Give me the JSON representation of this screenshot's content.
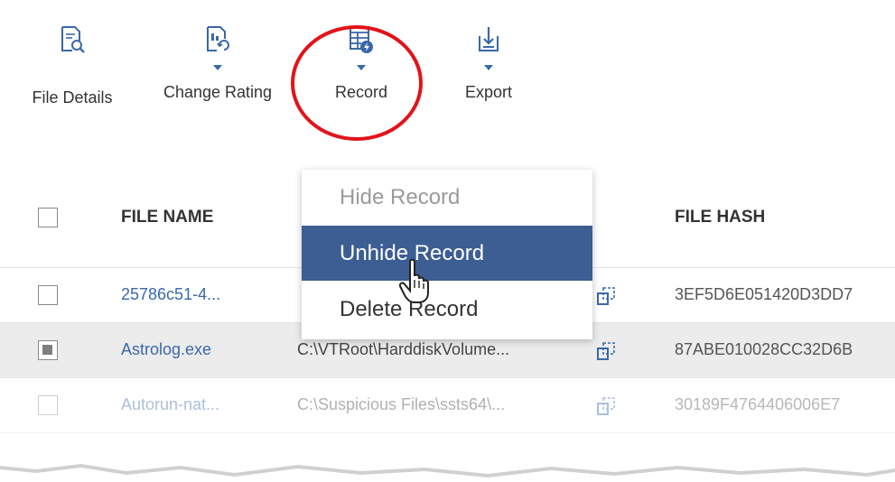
{
  "toolbar": {
    "items": [
      {
        "label": "File Details",
        "icon": "file-search-icon",
        "has_dropdown": false
      },
      {
        "label": "Change Rating",
        "icon": "file-refresh-icon",
        "has_dropdown": true
      },
      {
        "label": "Record",
        "icon": "record-lightning-icon",
        "has_dropdown": true
      },
      {
        "label": "Export",
        "icon": "export-icon",
        "has_dropdown": true
      }
    ],
    "highlight_color": "#e2131a"
  },
  "table": {
    "columns": [
      "FILE NAME",
      "FILE HASH"
    ],
    "rows": [
      {
        "checked": false,
        "name": "25786c51-4...",
        "path": "",
        "hash": "3EF5D6E051420D3DD7"
      },
      {
        "checked": true,
        "name": "Astrolog.exe",
        "path": "C:\\VTRoot\\HarddiskVolume...",
        "hash": "87ABE010028CC32D6B"
      },
      {
        "checked": false,
        "name": "Autorun-nat...",
        "path": "C:\\Suspicious Files\\ssts64\\...",
        "hash": "30189F4764406006E7"
      }
    ]
  },
  "record_menu": {
    "items": [
      {
        "label": "Hide Record",
        "state": "disabled"
      },
      {
        "label": "Unhide Record",
        "state": "hover"
      },
      {
        "label": "Delete Record",
        "state": "normal"
      }
    ],
    "active_color": "#3c5e93"
  },
  "colors": {
    "link": "#3a68a8",
    "selected_row": "#ececec"
  }
}
